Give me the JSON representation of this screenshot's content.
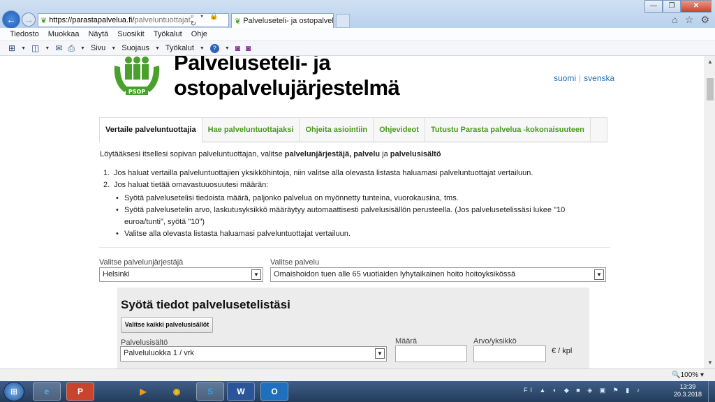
{
  "browser": {
    "url_host": "https://parastapalvelua.fi/",
    "url_path": "palveluntuottajat",
    "address_controls": "⌕ ▾ 🔒 ↻",
    "tab_title": "Palveluseteli- ja ostopalvelu...",
    "tab_close": "✕",
    "window_controls": {
      "minimize": "—",
      "restore": "❐",
      "close": "✕"
    },
    "toolbar_icons": [
      "home-icon",
      "star-icon",
      "gear-icon"
    ]
  },
  "menubar": {
    "items": [
      "Tiedosto",
      "Muokkaa",
      "Näytä",
      "Suosikit",
      "Työkalut",
      "Ohje"
    ]
  },
  "commandbar": {
    "page": "Sivu",
    "safety": "Suojaus",
    "tools": "Työkalut"
  },
  "page": {
    "site_title_line1": "Palveluseteli- ja",
    "site_title_line2": "ostopalvelujärjestelmä",
    "logo_text": "PSOP",
    "lang_fi": "suomi",
    "lang_sv": "svenska",
    "tabs": [
      "Vertaile palveluntuottajia",
      "Hae palveluntuottajaksi",
      "Ohjeita asiointiin",
      "Ohjevideot",
      "Tutustu Parasta palvelua -kokonaisuuteen"
    ],
    "intro_prefix": "Löytääksesi itsellesi sopivan palveluntuottajan, valitse ",
    "intro_bold1": "palvelunjärjestäjä, palvelu",
    "intro_mid": " ja ",
    "intro_bold2": "palvelusisältö",
    "step1_num": "1.",
    "step1": "Jos haluat vertailla palveluntuottajien yksikköhintoja, niin valitse alla olevasta listasta haluamasi palveluntuottajat vertailuun.",
    "step2_num": "2.",
    "step2": "Jos haluat tietää omavastuuosuutesi määrän:",
    "substeps": [
      "Syötä palvelusetelisi tiedoista määrä, paljonko palvelua on myönnetty tunteina, vuorokausina, tms.",
      "Syötä palvelusetelin arvo, laskutusyksikkö määräytyy automaattisesti palvelusisällön perusteella. (Jos palvelusetelissäsi lukee \"10 euroa/tunti\", syötä \"10\")",
      "Valitse alla olevasta listasta haluamasi palveluntuottajat vertailuun."
    ],
    "organizer_label": "Valitse palvelunjärjestäjä",
    "organizer_value": "Helsinki",
    "service_label": "Valitse palvelu",
    "service_value": "Omaishoidon tuen alle 65 vuotiaiden lyhytaikainen hoito hoitoyksikössä",
    "panel_title": "Syötä tiedot palvelusetelistäsi",
    "select_all_button": "Valitse kaikki palvelusisällöt",
    "content_label": "Palvelusisältö",
    "content_value": "Palveluluokka 1 / vrk",
    "amount_label": "Määrä",
    "unit_value_label": "Arvo/yksikkö",
    "unit_suffix": "€ / kpl"
  },
  "statusbar": {
    "zoom": "100%"
  },
  "taskbar": {
    "apps": [
      "Internet Explorer",
      "PowerPoint",
      "Media Player",
      "Chrome",
      "Skype",
      "Word",
      "Outlook"
    ],
    "lang": "FI",
    "time": "13:39",
    "date": "20.3.2018"
  }
}
